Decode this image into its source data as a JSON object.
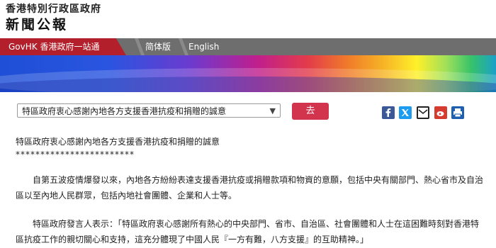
{
  "header": {
    "government": "香港特別行政區政府",
    "publication": "新聞公報"
  },
  "nav": {
    "govhk": "GovHK 香港政府一站通",
    "simplified": "简体版",
    "english": "English"
  },
  "toolbar": {
    "selected_article": "特區政府衷心感謝內地各方支援香港抗疫和捐贈的誠意",
    "go_label": "去",
    "share_icons": [
      "facebook-icon",
      "twitter-icon",
      "email-icon",
      "weibo-icon",
      "print-icon"
    ]
  },
  "article": {
    "title": "特區政府衷心感謝內地各方支援香港抗疫和捐贈的誠意",
    "stars": "************************",
    "paragraphs": [
      "自第五波疫情爆發以來，內地各方紛紛表達支援香港抗疫或捐贈款項和物資的意願，包括中央有關部門、熱心省市及自治區以至內地人民群眾，包括內地社會團體、企業和人士等。",
      "特區政府發言人表示：「特區政府衷心感謝所有熱心的中央部門、省市、自治區、社會團體和人士在這困難時刻對香港特區抗疫工作的親切關心和支持，這充分體現了中國人民『一方有難，八方支援』的互助精神。」"
    ]
  },
  "colors": {
    "govhk_red": "#b3202b",
    "go_button": "#d2334d",
    "nav_gray": "#6e6e6e"
  }
}
